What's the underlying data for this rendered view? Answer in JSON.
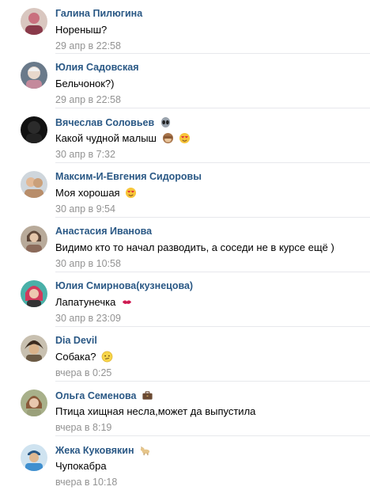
{
  "comments": [
    {
      "author": "Галина Пилюгина",
      "text": "Нореныш?",
      "date": "29 апр в 22:58",
      "avatar_color": "#c9707e"
    },
    {
      "author": "Юлия Садовская",
      "text": "Бельчонок?)",
      "date": "29 апр в 22:58",
      "avatar_color": "#c48a9c"
    },
    {
      "author": "Вячеслав Соловьев",
      "author_icon": "alien-icon",
      "text": "Какой чудной малыш",
      "text_icons": [
        "see-no-evil-monkey-icon",
        "heart-eyes-icon"
      ],
      "date": "30 апр в 7:32",
      "avatar_color": "#1a1a1a"
    },
    {
      "author": "Максим-И-Евгения Сидоровы",
      "text": "Моя хорошая",
      "text_icons": [
        "heart-eyes-icon"
      ],
      "date": "30 апр в 9:54",
      "avatar_color": "#b88d6a"
    },
    {
      "author": "Анастасия Иванова",
      "text": "Видимо кто то начал разводить, а соседи не в курсе ещё )",
      "date": "30 апр в 10:58",
      "avatar_color": "#8b6a5a"
    },
    {
      "author": "Юлия Смирнова(кузнецова)",
      "text": "Лапатунечка",
      "text_icons": [
        "kiss-icon"
      ],
      "date": "30 апр в 23:09",
      "avatar_color": "#d23a5c"
    },
    {
      "author": "Dia Devil",
      "text": "Собака?",
      "text_icons": [
        "confused-face-icon"
      ],
      "date": "вчера в 0:25",
      "avatar_color": "#6b5a45"
    },
    {
      "author": "Ольга Семенова",
      "author_icon": "briefcase-icon",
      "text": "Птица хищная несла,может да выпустила",
      "date": "вчера в 8:19",
      "avatar_color": "#9aa07a"
    },
    {
      "author": "Жека Куковякин",
      "author_icon": "dog-icon",
      "text": "Чупокабра",
      "date": "вчера в 10:18",
      "avatar_color": "#3f8fcf"
    }
  ]
}
